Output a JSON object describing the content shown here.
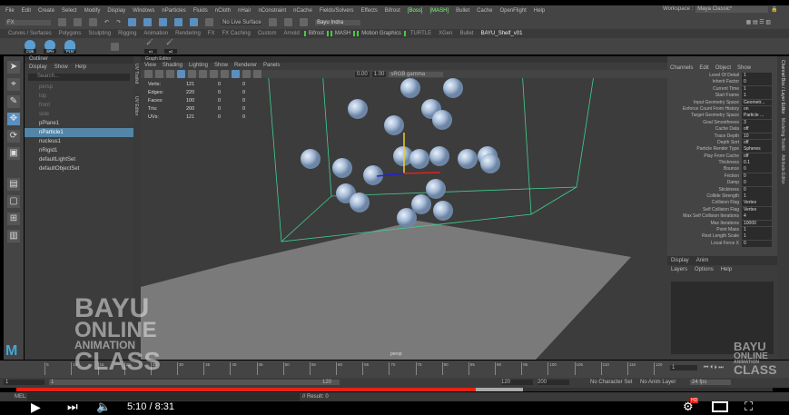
{
  "menu": [
    "File",
    "Edit",
    "Create",
    "Select",
    "Modify",
    "Display",
    "Windows",
    "nParticles",
    "Fluids",
    "nCloth",
    "nHair",
    "nConstraint",
    "nCache",
    "Fields/Solvers",
    "Effects",
    "Bifrost",
    "[Boss]",
    "[MASH]",
    "Bullet",
    "Cache",
    "OpenFlight",
    "Help"
  ],
  "workspace": {
    "label": "Workspace :",
    "value": "Maya Classic*"
  },
  "shelf": {
    "mode": "FX",
    "surface": "No Live Surface",
    "user": "Bayu Indra"
  },
  "shelf_tabs": [
    "Curves / Surfaces",
    "Polygons",
    "Sculpting",
    "Rigging",
    "Animation",
    "Rendering",
    "FX",
    "FX Caching",
    "Custom",
    "Arnold",
    "Bifrost",
    "MASH",
    "Motion Graphics",
    "TURTLE",
    "XGen",
    "Bullet",
    "BAYU_Shelf_v01"
  ],
  "shelf_icons": [
    "CUB",
    "SPH",
    "PLN",
    "n1",
    "n2"
  ],
  "outliner": {
    "title": "Outliner",
    "menu": [
      "Display",
      "Show",
      "Help"
    ],
    "search": "Search...",
    "items": [
      {
        "label": "persp",
        "dim": true
      },
      {
        "label": "top",
        "dim": true
      },
      {
        "label": "front",
        "dim": true
      },
      {
        "label": "side",
        "dim": true
      },
      {
        "label": "pPlane1"
      },
      {
        "label": "nParticle1",
        "sel": true
      },
      {
        "label": "nucleus1"
      },
      {
        "label": "nRigid1"
      },
      {
        "label": "defaultLightSet"
      },
      {
        "label": "defaultObjectSet"
      }
    ]
  },
  "side_tabs": [
    "UV Toolkit",
    "UV Editor"
  ],
  "viewport": {
    "panel_title": "Graph Editor",
    "menu": [
      "View",
      "Shading",
      "Lighting",
      "Show",
      "Renderer",
      "Panels"
    ],
    "field1": "0.00",
    "field2": "1.00",
    "colorspace": "sRGB gamma",
    "camera": "persp",
    "hud": [
      [
        "Verts:",
        "121",
        "0",
        "0"
      ],
      [
        "Edges:",
        "220",
        "0",
        "0"
      ],
      [
        "Faces:",
        "100",
        "0",
        "0"
      ],
      [
        "Tris:",
        "200",
        "0",
        "0"
      ],
      [
        "UVs:",
        "121",
        "0",
        "0"
      ]
    ]
  },
  "channel": {
    "menu": [
      "Channels",
      "Edit",
      "Object",
      "Show"
    ],
    "attrs": [
      [
        "Level Of Detail",
        "1"
      ],
      [
        "Inherit Factor",
        "0"
      ],
      [
        "Current Time",
        "1"
      ],
      [
        "Start Frame",
        "1"
      ],
      [
        "Input Geometry Space",
        "Geometr..."
      ],
      [
        "Enforce Count From History",
        "on"
      ],
      [
        "Target Geometry Space",
        "Particle ..."
      ],
      [
        "Goal Smoothness",
        "3"
      ],
      [
        "Cache Data",
        "off"
      ],
      [
        "Trace Depth",
        "10"
      ],
      [
        "Depth Sort",
        "off"
      ],
      [
        "Particle Render Type",
        "Spheres"
      ],
      [
        "Play From Cache",
        "off"
      ],
      [
        "Thickness",
        "0.1"
      ],
      [
        "Bounce",
        "0"
      ],
      [
        "Friction",
        "0"
      ],
      [
        "Damp",
        "0"
      ],
      [
        "Stickiness",
        "0"
      ],
      [
        "Collide Strength",
        "1"
      ],
      [
        "Collision Flag",
        "Vertex"
      ],
      [
        "Self Collision Flag",
        "Vertex"
      ],
      [
        "Max Self Collision Iterations",
        "4"
      ],
      [
        "Max Iterations",
        "10000"
      ],
      [
        "Point Mass",
        "1"
      ],
      [
        "Rest Length Scale",
        "1"
      ],
      [
        "Local Force X",
        "0"
      ]
    ],
    "layer_tabs": [
      "Display",
      "Anim"
    ],
    "layer_menu": [
      "Layers",
      "Options",
      "Help"
    ]
  },
  "vtabs": [
    "Channel Box / Layer Editor",
    "Modeling Toolkit",
    "Attribute Editor"
  ],
  "timeline": {
    "ticks": [
      "5",
      "10",
      "15",
      "20",
      "25",
      "30",
      "35",
      "40",
      "45",
      "50",
      "55",
      "60",
      "65",
      "70",
      "75",
      "80",
      "85",
      "90",
      "95",
      "100",
      "105",
      "110",
      "115",
      "120"
    ],
    "current": "1"
  },
  "range": {
    "start": "1",
    "inner_start": "1",
    "inner_end": "120",
    "end": "120",
    "max": "200",
    "charset": "No Character Set",
    "animlayer": "No Anim Layer",
    "fps": "24 fps"
  },
  "cmd": {
    "label": "MEL",
    "result": "// Result: 0"
  },
  "watermark": {
    "line1": "BAYU",
    "line2": "ONLINE",
    "line3": "ANIMATION",
    "line4": "CLASS"
  },
  "player": {
    "time": "5:10 / 8:31",
    "progress": 0.607,
    "buffered": 0.67,
    "hd": "HD",
    "brand": "#e62117"
  }
}
